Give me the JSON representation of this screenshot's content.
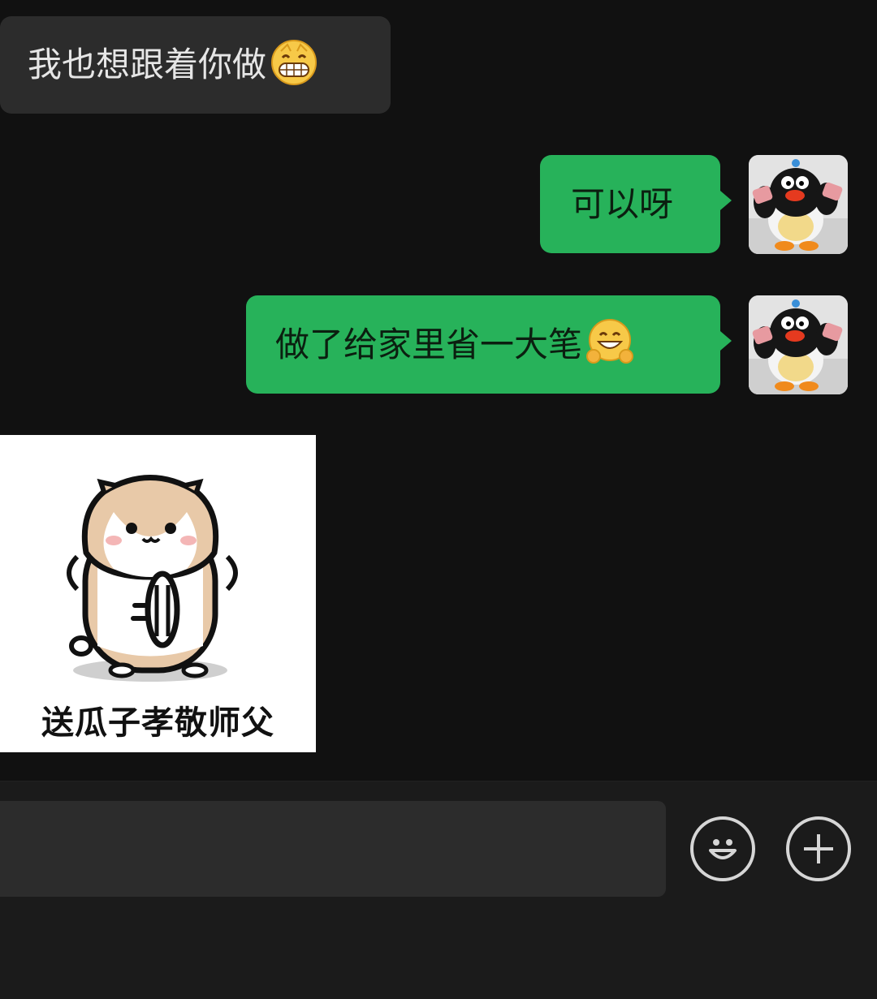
{
  "messages": [
    {
      "side": "incoming",
      "text": "我也想跟着你做",
      "emoji": "grinning-face-icon"
    },
    {
      "side": "outgoing",
      "text": "可以呀"
    },
    {
      "side": "outgoing",
      "text": "做了给家里省一大笔",
      "emoji": "hugging-face-icon"
    },
    {
      "side": "incoming",
      "type": "sticker",
      "caption": "送瓜子孝敬师父",
      "sticker_icon": "hamster-sunflower-seed-sticker"
    }
  ],
  "composer": {
    "placeholder": ""
  },
  "colors": {
    "background": "#111111",
    "incoming_bubble": "#2c2c2c",
    "outgoing_bubble": "#27b25a"
  }
}
